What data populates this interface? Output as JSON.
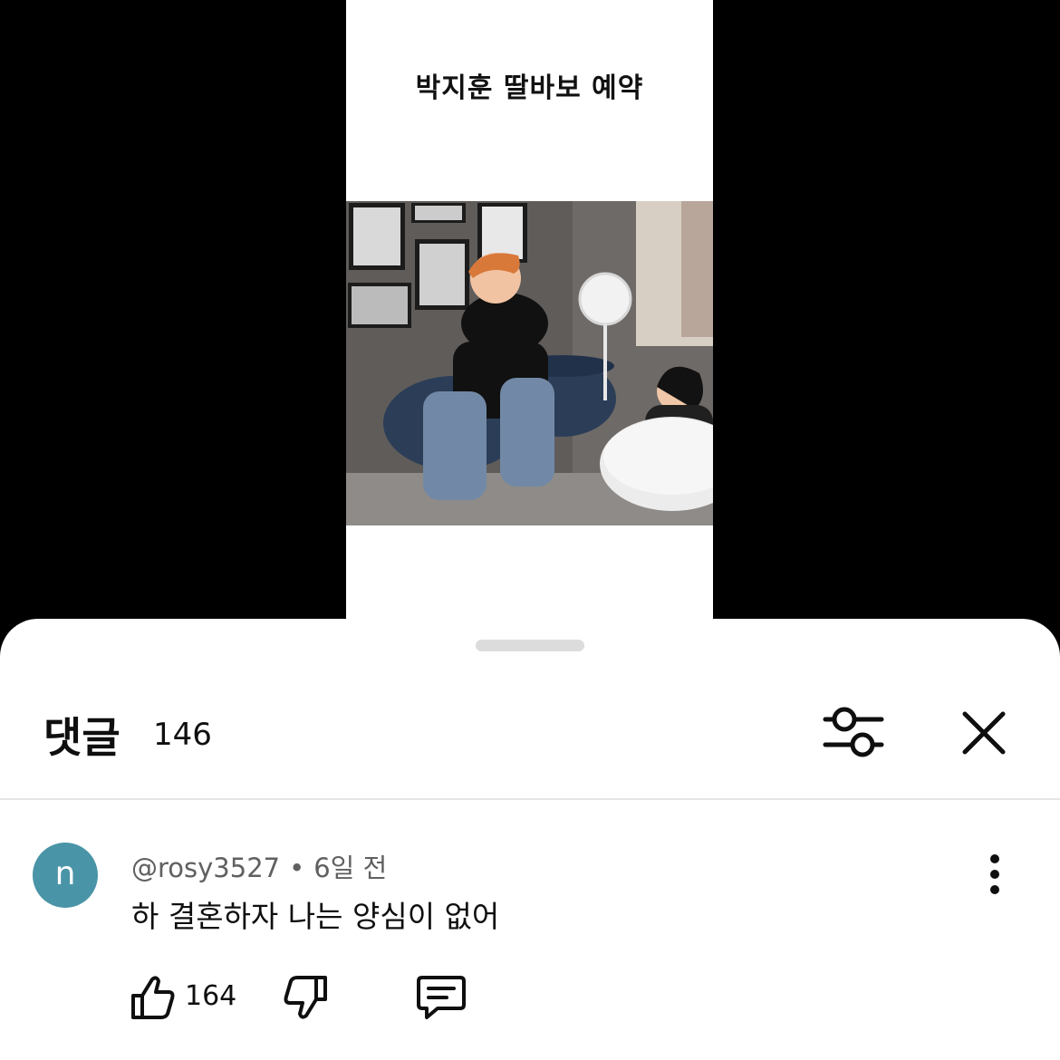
{
  "video": {
    "caption": "박지훈 딸바보 예약"
  },
  "comments_panel": {
    "title": "댓글",
    "count": "146"
  },
  "comment": {
    "avatar_letter": "n",
    "author": "@rosy3527",
    "separator": "•",
    "time": "6일 전",
    "text": "하 결혼하자 나는 양심이 없어",
    "likes": "164"
  },
  "colors": {
    "avatar_bg": "#4a94a7",
    "text_primary": "#0f0f0f",
    "text_secondary": "#606060"
  },
  "icons": {
    "filter": "sliders-icon",
    "close": "close-icon",
    "more": "vertical-dots-icon",
    "like": "thumbs-up-icon",
    "dislike": "thumbs-down-icon",
    "reply": "comment-icon"
  }
}
